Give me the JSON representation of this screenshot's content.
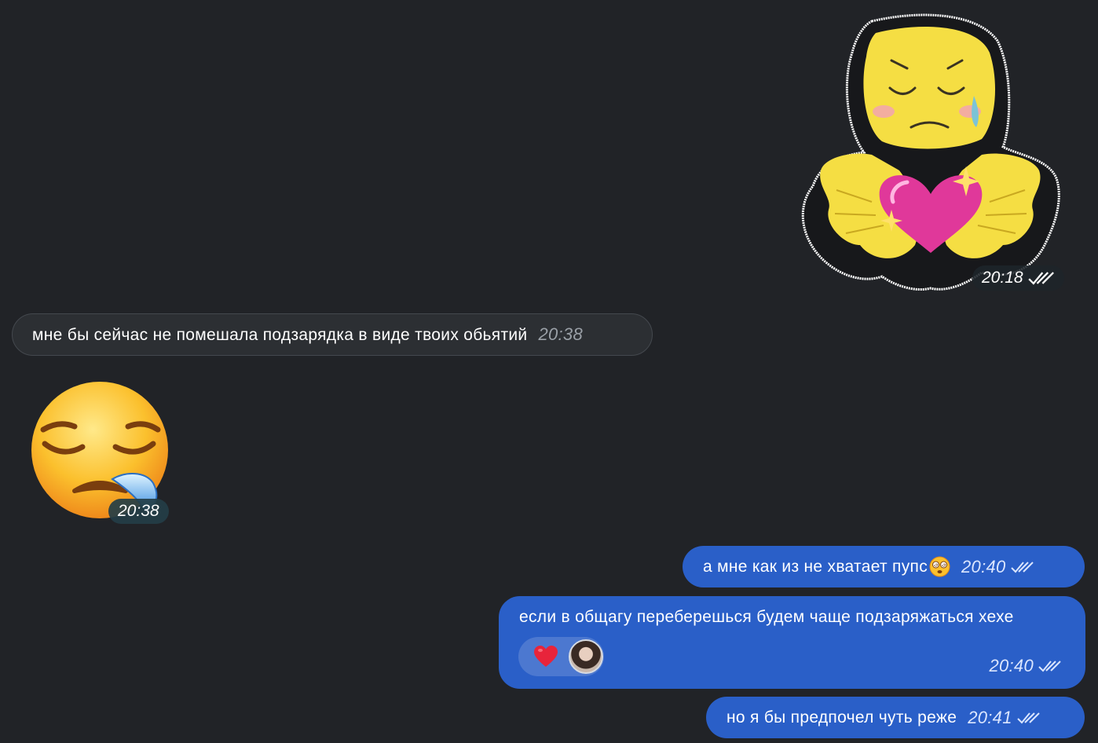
{
  "app": {
    "background": "#212327",
    "outgoing_color": "#2a5fc8",
    "incoming_color": "#2c2f33"
  },
  "messages": [
    {
      "type": "sticker",
      "direction": "outgoing",
      "content": "crying-blob-with-heart-sticker",
      "time": "20:18",
      "status": "read-double-check"
    },
    {
      "type": "text",
      "direction": "incoming",
      "text": "мне бы сейчас не помешала подзарядка в виде твоих обьятий",
      "time": "20:38"
    },
    {
      "type": "emoji",
      "direction": "incoming",
      "content": "sleepy-face-emoji",
      "time": "20:38"
    },
    {
      "type": "text",
      "direction": "outgoing",
      "text": "а мне как из не хватает пупс",
      "emoji": "dizzy-face-emoji",
      "time": "20:40",
      "status": "read-double-check"
    },
    {
      "type": "text",
      "direction": "outgoing",
      "text": "если в общагу переберешься будем чаще подзаряжаться хехе",
      "time": "20:40",
      "status": "read-double-check",
      "reactions": [
        {
          "emoji": "heart-icon",
          "color": "#e8243b"
        },
        {
          "emoji": "user-avatar"
        }
      ]
    },
    {
      "type": "text",
      "direction": "outgoing",
      "text": "но я бы предпочел чуть реже",
      "time": "20:41",
      "status": "read-double-check"
    }
  ]
}
